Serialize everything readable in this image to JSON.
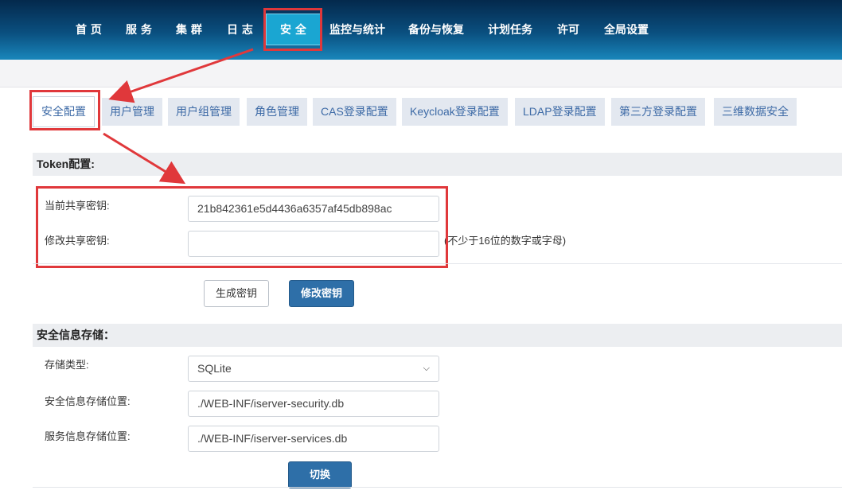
{
  "nav": {
    "items": [
      "首 页",
      "服 务",
      "集 群",
      "日 志",
      "安 全",
      "监控与统计",
      "备份与恢复",
      "计划任务",
      "许可",
      "全局设置"
    ],
    "active": "安 全"
  },
  "tabs": [
    "安全配置",
    "用户管理",
    "用户组管理",
    "角色管理",
    "CAS登录配置",
    "Keycloak登录配置",
    "LDAP登录配置",
    "第三方登录配置",
    "三维数据安全"
  ],
  "token": {
    "section_title": "Token配置:",
    "current_key_label": "当前共享密钥:",
    "current_key_value": "21b842361e5d4436a6357af45db898ac",
    "modify_key_label": "修改共享密钥:",
    "modify_key_value": "",
    "hint": "(不少于16位的数字或字母)",
    "generate_button": "生成密钥",
    "modify_button": "修改密钥"
  },
  "storage": {
    "section_title": "安全信息存储：",
    "type_label": "存储类型:",
    "type_value": "SQLite",
    "security_path_label": "安全信息存储位置:",
    "security_path_value": "./WEB-INF/iserver-security.db",
    "services_path_label": "服务信息存储位置:",
    "services_path_value": "./WEB-INF/iserver-services.db",
    "switch_button": "切换"
  },
  "colors": {
    "highlight": "#e0383b",
    "primary_button": "#2e6fa8",
    "tab_text": "#3d6aa6"
  }
}
